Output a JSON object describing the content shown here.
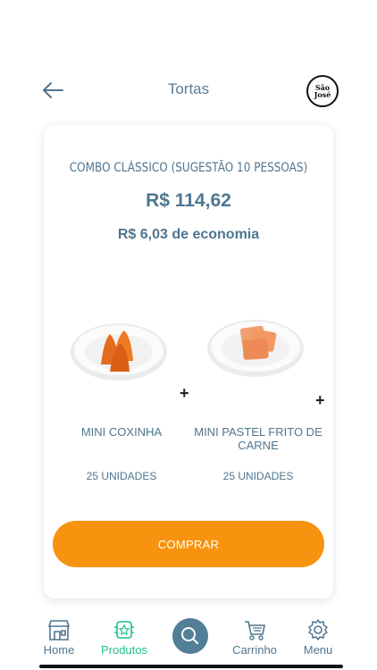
{
  "header": {
    "title": "Tortas",
    "back_icon": "arrow-left-icon",
    "logo_text_1": "São",
    "logo_text_2": "José"
  },
  "combo": {
    "title": "COMBO CLÁSSICO (SUGESTÃO 10 PESSOAS)",
    "price": "R$ 114,62",
    "saving": "R$ 6,03 de economia",
    "products": [
      {
        "name": "MINI COXINHA",
        "quantity": "25 UNIDADES"
      },
      {
        "name": "MINI PASTEL FRITO DE CARNE",
        "quantity": "25 UNIDADES"
      }
    ],
    "plus": "+",
    "buy_label": "COMPRAR"
  },
  "tabbar": {
    "items": [
      {
        "label": "Home",
        "icon": "store-icon"
      },
      {
        "label": "Produtos",
        "icon": "products-icon",
        "active": true
      },
      {
        "label": "",
        "icon": "search-icon"
      },
      {
        "label": "Carrinho",
        "icon": "cart-icon"
      },
      {
        "label": "Menu",
        "icon": "gear-icon"
      }
    ]
  },
  "colors": {
    "primary_text": "#4f7690",
    "accent": "#f7930e",
    "active_tab": "#1fbf8f",
    "fab": "#527e97"
  }
}
